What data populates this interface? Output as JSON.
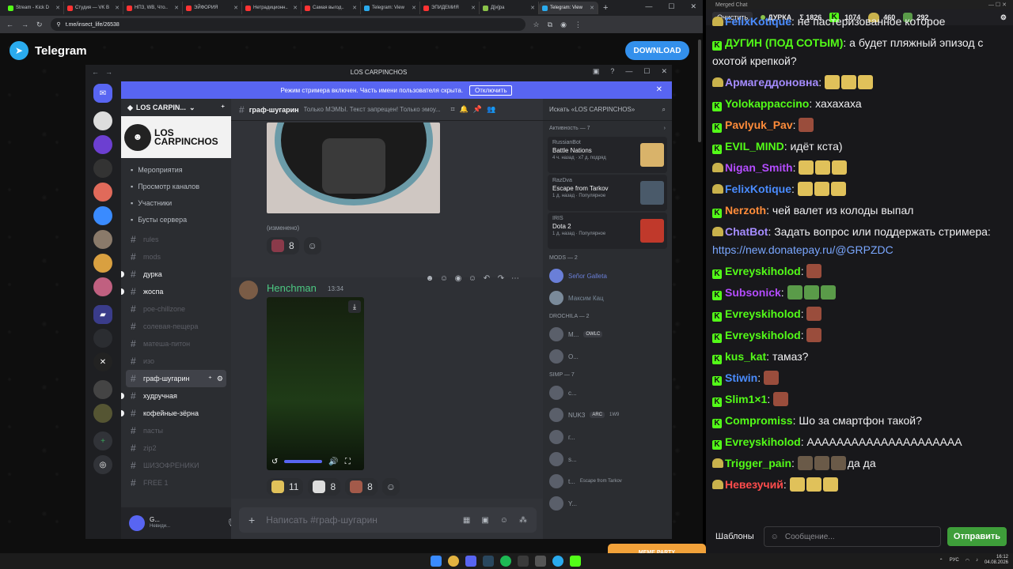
{
  "browser": {
    "tabs": [
      {
        "label": "Stream - Kick D",
        "color": "#53fc18"
      },
      {
        "label": "Студия — VK В",
        "color": "#ff3333"
      },
      {
        "label": "НПЗ, WB, Что..",
        "color": "#ff3333"
      },
      {
        "label": "ЭЙФОРИЯ",
        "color": "#ff3333"
      },
      {
        "label": "Нетрадиционн..",
        "color": "#ff3333"
      },
      {
        "label": "Самая выгод..",
        "color": "#ff3333"
      },
      {
        "label": "Telegram: View",
        "color": "#2aabee"
      },
      {
        "label": "ЭПИДЕМИЯ",
        "color": "#ff3333"
      },
      {
        "label": "Д[и]ра",
        "color": "#8bc34a"
      },
      {
        "label": "Telegram: View",
        "color": "#2aabee",
        "active": true
      }
    ],
    "url": "t.me/insect_life/26538"
  },
  "telegram": {
    "title": "Telegram",
    "download_label": "DOWNLOAD"
  },
  "discord": {
    "window_title": "LOS CARPINCHOS",
    "stream_notice": "Режим стримера включен. Часть имени пользователя скрыта.",
    "stream_button": "Отключить",
    "server_name": "LOS CARPIN...",
    "banner_text": "LOS CARPINCHOS",
    "menu": [
      "Мероприятия",
      "Просмотр каналов",
      "Участники",
      "Бусты сервера"
    ],
    "channels": [
      {
        "name": "rules",
        "state": "muted"
      },
      {
        "name": "mods",
        "state": "muted"
      },
      {
        "name": "дурка",
        "state": "unread"
      },
      {
        "name": "жоспа",
        "state": "unread"
      },
      {
        "name": "poe-chillzone",
        "state": "muted"
      },
      {
        "name": "солевая-пещера",
        "state": "muted"
      },
      {
        "name": "матеша-питон",
        "state": "muted"
      },
      {
        "name": "изо",
        "state": "muted"
      },
      {
        "name": "граф-шугарин",
        "state": "active"
      },
      {
        "name": "худручная",
        "state": "unread"
      },
      {
        "name": "кофейные-зёрна",
        "state": "unread"
      },
      {
        "name": "пасты",
        "state": "muted"
      },
      {
        "name": "zip2",
        "state": "muted"
      },
      {
        "name": "ШИЗОФРЕНИКИ",
        "state": "muted"
      },
      {
        "name": "FREE 1",
        "state": "muted"
      }
    ],
    "user": {
      "name": "G...",
      "status": "Невиди..."
    },
    "channel_header": {
      "name": "граф-шугарин",
      "topic": "Только МЭМЫ. Текст запрещен! Только эмоу..."
    },
    "search_placeholder": "Искать «LOS CARPINCHOS»",
    "edited_label": "(изменено)",
    "reactions_top": [
      {
        "count": "8"
      }
    ],
    "message": {
      "author": "Henchman",
      "time": "13:34"
    },
    "reactions_bottom": [
      {
        "count": "11",
        "color": "#e0c15a"
      },
      {
        "count": "8",
        "color": "#ddd"
      },
      {
        "count": "8",
        "color": "#a35a4a"
      }
    ],
    "input_placeholder": "Написать #граф-шугарин",
    "activity_header": "Активность — 7",
    "activities": [
      {
        "who": "RussianBot",
        "game": "Battle Nations",
        "meta": "4 ч. назад · x7 д. подряд",
        "color": "#d9b36a"
      },
      {
        "who": "RazDva",
        "game": "Escape from Tarkov",
        "meta": "1 д. назад · Популярное",
        "color": "#4a5a6a"
      },
      {
        "who": "IRIS",
        "game": "Dota 2",
        "meta": "1 д. назад · Популярное",
        "color": "#c0392b"
      }
    ],
    "mods_header": "MODS — 2",
    "mods": [
      {
        "name": "Señor Galleta",
        "color": "#6a7fd8"
      },
      {
        "name": "Максим Кац",
        "color": "#7a8a9a"
      }
    ],
    "drochila_header": "DROCHILA — 2",
    "drochila": [
      {
        "name": "M...",
        "tag": "OWLC"
      },
      {
        "name": "O..."
      }
    ],
    "simp_header": "SIMP — 7",
    "simp": [
      {
        "name": "c..."
      },
      {
        "name": "NUK3",
        "tag": "ARC",
        "sub": "1W9"
      },
      {
        "name": "г..."
      },
      {
        "name": "s..."
      },
      {
        "name": "t...",
        "sub": "Escape from Tarkov"
      },
      {
        "name": "Y..."
      }
    ]
  },
  "merged_chat": {
    "title": "Merged Chat",
    "clear_label": "Очистить",
    "channel": "ДУРКА",
    "stats": [
      "Σ 1826",
      "1074",
      "460",
      "292"
    ],
    "lines": [
      {
        "p": "tw",
        "user": "FelixKotique",
        "color": "#4a8cff",
        "text": "не пастеризованное которое"
      },
      {
        "p": "k",
        "user": "ДУГИН (ПОД СОТЫМ)",
        "color": "#53fc18",
        "text": "а будет пляжный эпизод с охотой крепкой?",
        "wrap": true
      },
      {
        "p": "tw",
        "user": "Армагеддоновна",
        "color": "#a58cff",
        "text": "",
        "emotes": [
          "cat",
          "cat",
          "cat"
        ]
      },
      {
        "p": "k",
        "user": "Yolokappaccino",
        "color": "#53fc18",
        "text": "хахахаха"
      },
      {
        "p": "k",
        "user": "Pavlyuk_Pav",
        "color": "#ff8c3a",
        "text": "",
        "emotes": [
          "face"
        ]
      },
      {
        "p": "k",
        "user": "EVIL_MIND",
        "color": "#53fc18",
        "text": "идёт кста)"
      },
      {
        "p": "tw",
        "user": "Nigan_Smith",
        "color": "#b44cff",
        "text": "",
        "emotes": [
          "cat",
          "cat",
          "cat"
        ]
      },
      {
        "p": "tw",
        "user": "FelixKotique",
        "color": "#4a8cff",
        "text": "",
        "emotes": [
          "cat",
          "cat",
          "cat"
        ]
      },
      {
        "p": "k",
        "user": "Nerzoth",
        "color": "#ff8c3a",
        "text": "чей валет из колоды выпал"
      },
      {
        "p": "tw",
        "user": "ChatBot",
        "color": "#a58cff",
        "text": "Задать вопрос или поддержать стримера:",
        "link": "https://new.donatepay.ru/@GRPZDC",
        "wrap": true
      },
      {
        "p": "k",
        "user": "Evreyskiholod",
        "color": "#53fc18",
        "text": "",
        "emotes": [
          "face"
        ]
      },
      {
        "p": "k",
        "user": "Subsonick",
        "color": "#b44cff",
        "text": "",
        "emotes": [
          "frog",
          "frog",
          "frog"
        ]
      },
      {
        "p": "k",
        "user": "Evreyskiholod",
        "color": "#53fc18",
        "text": "",
        "emotes": [
          "face"
        ]
      },
      {
        "p": "k",
        "user": "Evreyskiholod",
        "color": "#53fc18",
        "text": "",
        "emotes": [
          "face"
        ]
      },
      {
        "p": "k",
        "user": "kus_kat",
        "color": "#53fc18",
        "text": "тамаз?"
      },
      {
        "p": "k",
        "user": "Stiwin",
        "color": "#4a8cff",
        "text": "",
        "emotes": [
          "face"
        ]
      },
      {
        "p": "k",
        "user": "Slim1×1",
        "color": "#53fc18",
        "text": "",
        "emotes": [
          "face"
        ]
      },
      {
        "p": "k",
        "user": "Compromiss",
        "color": "#53fc18",
        "text": "Шо за смартфон такой?"
      },
      {
        "p": "k",
        "user": "Evreyskiholod",
        "color": "#53fc18",
        "text": "ААААААААААААААААААААА"
      },
      {
        "p": "tw",
        "user": "Trigger_pain",
        "color": "#53fc18",
        "text": "да да",
        "emotes": [
          "box",
          "box",
          "box"
        ]
      },
      {
        "p": "tw",
        "user": "Невезучий",
        "color": "#ff4c4c",
        "text": "",
        "emotes": [
          "cat",
          "cat",
          "cat"
        ]
      }
    ],
    "templates_label": "Шаблоны",
    "input_placeholder": "Сообщение...",
    "send_label": "Отправить"
  },
  "overlay": {
    "meme_party": "MEME PARTY"
  },
  "taskbar": {
    "lang": "РУС",
    "time": "16:12",
    "date": "04.08.2026"
  }
}
